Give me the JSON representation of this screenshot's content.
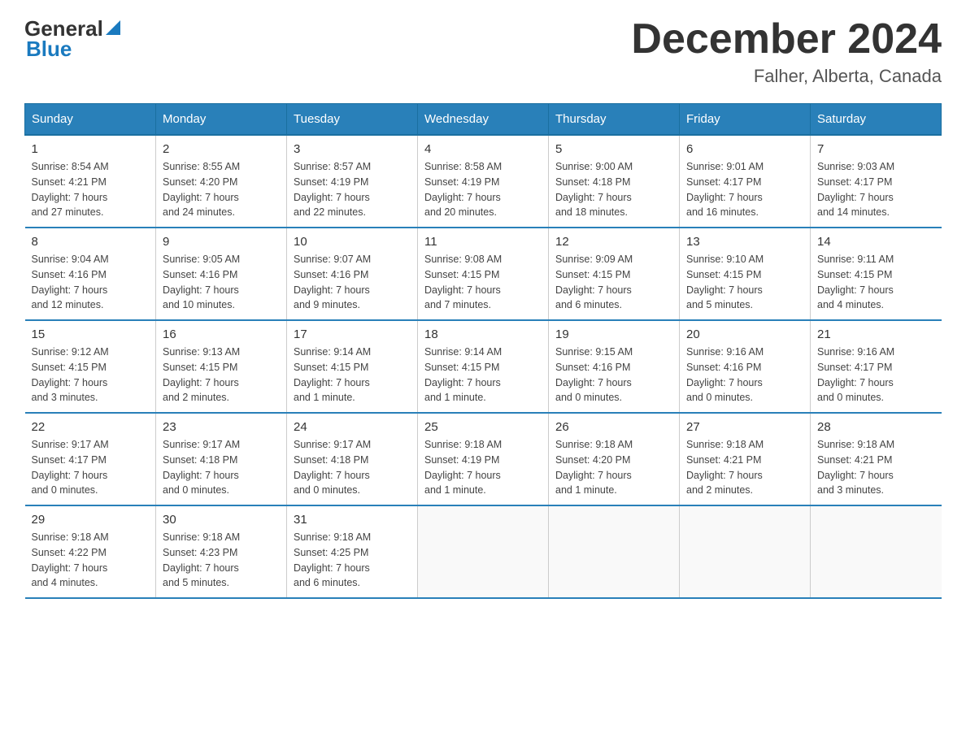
{
  "header": {
    "logo_general": "General",
    "logo_blue": "Blue",
    "month_title": "December 2024",
    "location": "Falher, Alberta, Canada"
  },
  "days_of_week": [
    "Sunday",
    "Monday",
    "Tuesday",
    "Wednesday",
    "Thursday",
    "Friday",
    "Saturday"
  ],
  "weeks": [
    [
      {
        "day": "1",
        "sunrise": "Sunrise: 8:54 AM",
        "sunset": "Sunset: 4:21 PM",
        "daylight": "Daylight: 7 hours",
        "daylight2": "and 27 minutes."
      },
      {
        "day": "2",
        "sunrise": "Sunrise: 8:55 AM",
        "sunset": "Sunset: 4:20 PM",
        "daylight": "Daylight: 7 hours",
        "daylight2": "and 24 minutes."
      },
      {
        "day": "3",
        "sunrise": "Sunrise: 8:57 AM",
        "sunset": "Sunset: 4:19 PM",
        "daylight": "Daylight: 7 hours",
        "daylight2": "and 22 minutes."
      },
      {
        "day": "4",
        "sunrise": "Sunrise: 8:58 AM",
        "sunset": "Sunset: 4:19 PM",
        "daylight": "Daylight: 7 hours",
        "daylight2": "and 20 minutes."
      },
      {
        "day": "5",
        "sunrise": "Sunrise: 9:00 AM",
        "sunset": "Sunset: 4:18 PM",
        "daylight": "Daylight: 7 hours",
        "daylight2": "and 18 minutes."
      },
      {
        "day": "6",
        "sunrise": "Sunrise: 9:01 AM",
        "sunset": "Sunset: 4:17 PM",
        "daylight": "Daylight: 7 hours",
        "daylight2": "and 16 minutes."
      },
      {
        "day": "7",
        "sunrise": "Sunrise: 9:03 AM",
        "sunset": "Sunset: 4:17 PM",
        "daylight": "Daylight: 7 hours",
        "daylight2": "and 14 minutes."
      }
    ],
    [
      {
        "day": "8",
        "sunrise": "Sunrise: 9:04 AM",
        "sunset": "Sunset: 4:16 PM",
        "daylight": "Daylight: 7 hours",
        "daylight2": "and 12 minutes."
      },
      {
        "day": "9",
        "sunrise": "Sunrise: 9:05 AM",
        "sunset": "Sunset: 4:16 PM",
        "daylight": "Daylight: 7 hours",
        "daylight2": "and 10 minutes."
      },
      {
        "day": "10",
        "sunrise": "Sunrise: 9:07 AM",
        "sunset": "Sunset: 4:16 PM",
        "daylight": "Daylight: 7 hours",
        "daylight2": "and 9 minutes."
      },
      {
        "day": "11",
        "sunrise": "Sunrise: 9:08 AM",
        "sunset": "Sunset: 4:15 PM",
        "daylight": "Daylight: 7 hours",
        "daylight2": "and 7 minutes."
      },
      {
        "day": "12",
        "sunrise": "Sunrise: 9:09 AM",
        "sunset": "Sunset: 4:15 PM",
        "daylight": "Daylight: 7 hours",
        "daylight2": "and 6 minutes."
      },
      {
        "day": "13",
        "sunrise": "Sunrise: 9:10 AM",
        "sunset": "Sunset: 4:15 PM",
        "daylight": "Daylight: 7 hours",
        "daylight2": "and 5 minutes."
      },
      {
        "day": "14",
        "sunrise": "Sunrise: 9:11 AM",
        "sunset": "Sunset: 4:15 PM",
        "daylight": "Daylight: 7 hours",
        "daylight2": "and 4 minutes."
      }
    ],
    [
      {
        "day": "15",
        "sunrise": "Sunrise: 9:12 AM",
        "sunset": "Sunset: 4:15 PM",
        "daylight": "Daylight: 7 hours",
        "daylight2": "and 3 minutes."
      },
      {
        "day": "16",
        "sunrise": "Sunrise: 9:13 AM",
        "sunset": "Sunset: 4:15 PM",
        "daylight": "Daylight: 7 hours",
        "daylight2": "and 2 minutes."
      },
      {
        "day": "17",
        "sunrise": "Sunrise: 9:14 AM",
        "sunset": "Sunset: 4:15 PM",
        "daylight": "Daylight: 7 hours",
        "daylight2": "and 1 minute."
      },
      {
        "day": "18",
        "sunrise": "Sunrise: 9:14 AM",
        "sunset": "Sunset: 4:15 PM",
        "daylight": "Daylight: 7 hours",
        "daylight2": "and 1 minute."
      },
      {
        "day": "19",
        "sunrise": "Sunrise: 9:15 AM",
        "sunset": "Sunset: 4:16 PM",
        "daylight": "Daylight: 7 hours",
        "daylight2": "and 0 minutes."
      },
      {
        "day": "20",
        "sunrise": "Sunrise: 9:16 AM",
        "sunset": "Sunset: 4:16 PM",
        "daylight": "Daylight: 7 hours",
        "daylight2": "and 0 minutes."
      },
      {
        "day": "21",
        "sunrise": "Sunrise: 9:16 AM",
        "sunset": "Sunset: 4:17 PM",
        "daylight": "Daylight: 7 hours",
        "daylight2": "and 0 minutes."
      }
    ],
    [
      {
        "day": "22",
        "sunrise": "Sunrise: 9:17 AM",
        "sunset": "Sunset: 4:17 PM",
        "daylight": "Daylight: 7 hours",
        "daylight2": "and 0 minutes."
      },
      {
        "day": "23",
        "sunrise": "Sunrise: 9:17 AM",
        "sunset": "Sunset: 4:18 PM",
        "daylight": "Daylight: 7 hours",
        "daylight2": "and 0 minutes."
      },
      {
        "day": "24",
        "sunrise": "Sunrise: 9:17 AM",
        "sunset": "Sunset: 4:18 PM",
        "daylight": "Daylight: 7 hours",
        "daylight2": "and 0 minutes."
      },
      {
        "day": "25",
        "sunrise": "Sunrise: 9:18 AM",
        "sunset": "Sunset: 4:19 PM",
        "daylight": "Daylight: 7 hours",
        "daylight2": "and 1 minute."
      },
      {
        "day": "26",
        "sunrise": "Sunrise: 9:18 AM",
        "sunset": "Sunset: 4:20 PM",
        "daylight": "Daylight: 7 hours",
        "daylight2": "and 1 minute."
      },
      {
        "day": "27",
        "sunrise": "Sunrise: 9:18 AM",
        "sunset": "Sunset: 4:21 PM",
        "daylight": "Daylight: 7 hours",
        "daylight2": "and 2 minutes."
      },
      {
        "day": "28",
        "sunrise": "Sunrise: 9:18 AM",
        "sunset": "Sunset: 4:21 PM",
        "daylight": "Daylight: 7 hours",
        "daylight2": "and 3 minutes."
      }
    ],
    [
      {
        "day": "29",
        "sunrise": "Sunrise: 9:18 AM",
        "sunset": "Sunset: 4:22 PM",
        "daylight": "Daylight: 7 hours",
        "daylight2": "and 4 minutes."
      },
      {
        "day": "30",
        "sunrise": "Sunrise: 9:18 AM",
        "sunset": "Sunset: 4:23 PM",
        "daylight": "Daylight: 7 hours",
        "daylight2": "and 5 minutes."
      },
      {
        "day": "31",
        "sunrise": "Sunrise: 9:18 AM",
        "sunset": "Sunset: 4:25 PM",
        "daylight": "Daylight: 7 hours",
        "daylight2": "and 6 minutes."
      },
      null,
      null,
      null,
      null
    ]
  ]
}
